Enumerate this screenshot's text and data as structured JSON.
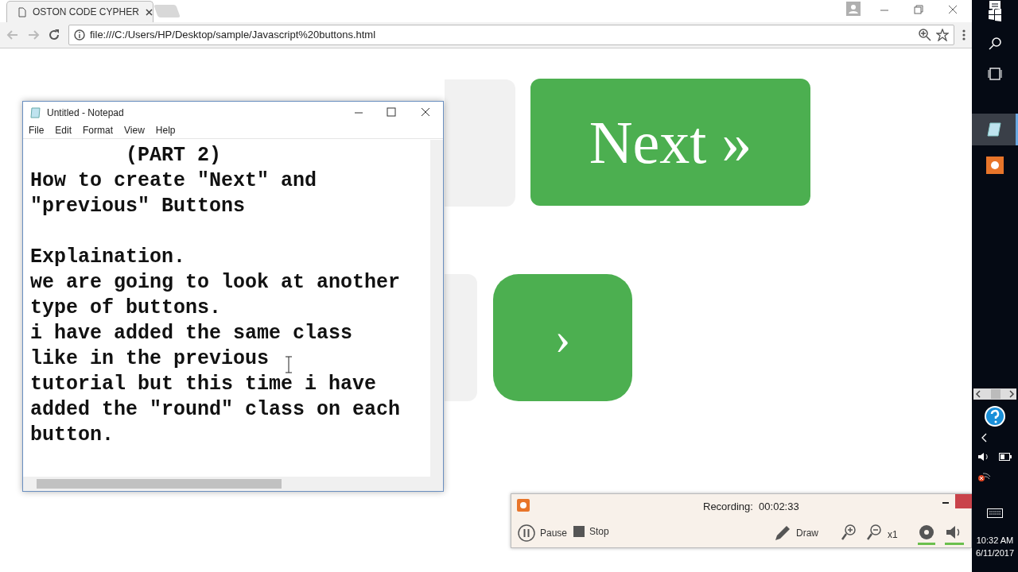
{
  "browser": {
    "tab": {
      "title": "OSTON CODE CYPHER",
      "selected": true
    },
    "address": "file:///C:/Users/HP/Desktop/sample/Javascript%20buttons.html"
  },
  "page": {
    "buttons": [
      {
        "label": "Next »",
        "kind": "square"
      },
      {
        "label": "›",
        "kind": "round"
      }
    ]
  },
  "notepad": {
    "title": "Untitled - Notepad",
    "menu": [
      "File",
      "Edit",
      "Format",
      "View",
      "Help"
    ],
    "paragraphs": [
      [
        "        (PART 2)",
        "How to create \"Next\" and",
        "\"previous\" Buttons"
      ],
      [
        "Explaination.",
        "we are going to look at another",
        "type of buttons.",
        "i have added the same class",
        "like in the previous",
        "tutorial but this time i have",
        "added the \"round\" class on each",
        "button."
      ]
    ]
  },
  "recorder": {
    "status": "Recording:",
    "time": "00:02:33",
    "controls": [
      {
        "label": "Pause",
        "kind": "pause"
      },
      {
        "label": "Stop",
        "kind": "stop"
      },
      {
        "label": "Draw",
        "kind": "draw"
      }
    ],
    "zoom": "x1"
  },
  "taskbar": {
    "time": "10:32 AM",
    "date": "6/11/2017"
  }
}
